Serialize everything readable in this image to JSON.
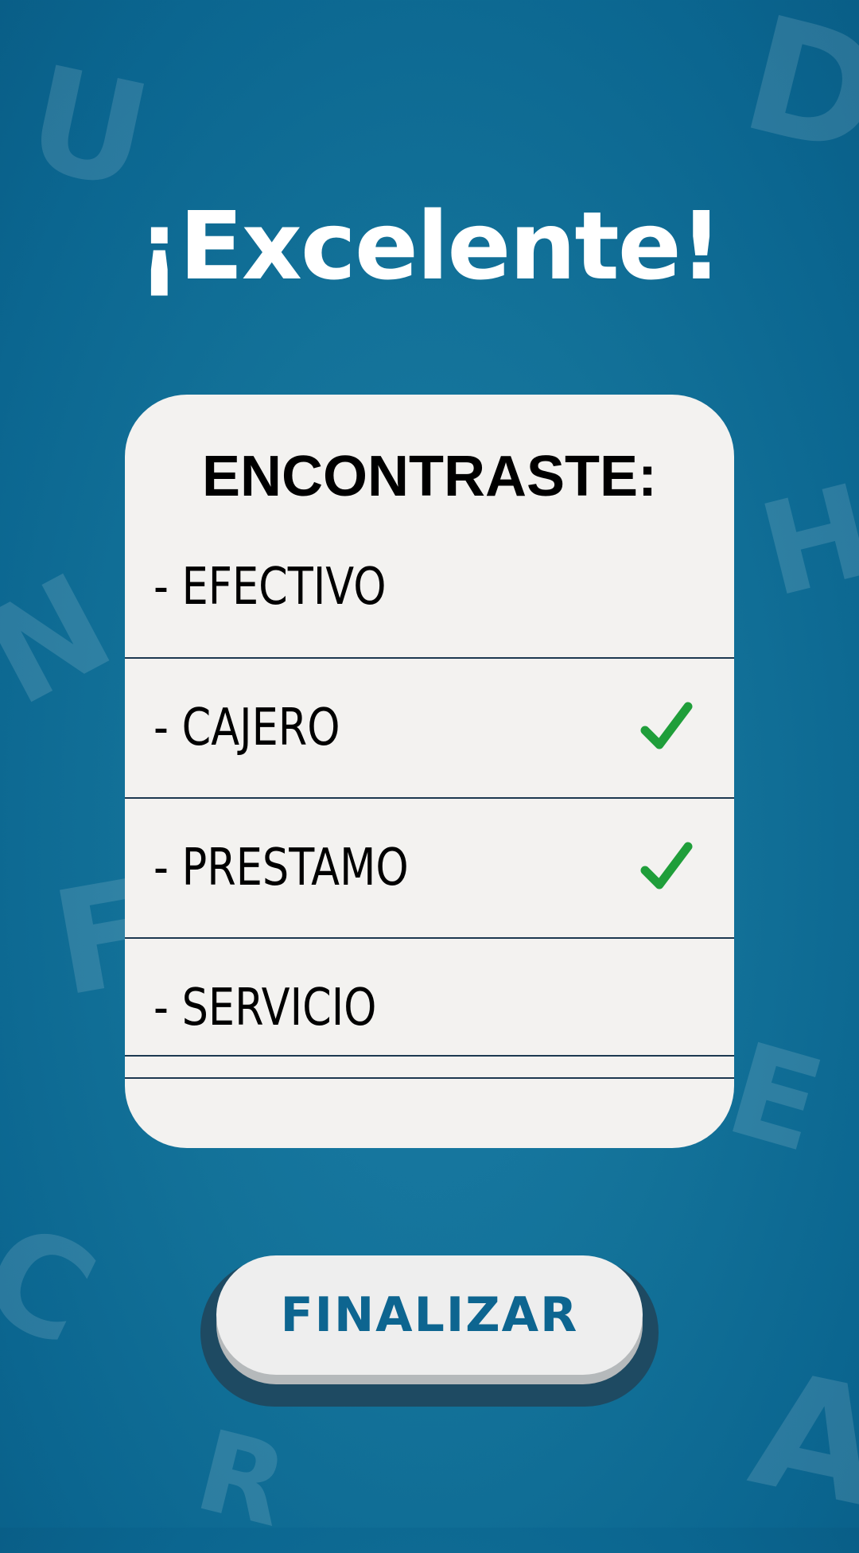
{
  "background_letters": [
    "U",
    "D",
    "H",
    "N",
    "F",
    "E",
    "C",
    "R",
    "A"
  ],
  "title": "¡Excelente!",
  "card": {
    "header": "ENCONTRASTE:",
    "items": [
      {
        "label": "- EFECTIVO",
        "found": false
      },
      {
        "label": "- CAJERO",
        "found": true
      },
      {
        "label": "- PRESTAMO",
        "found": true
      },
      {
        "label": "- SERVICIO",
        "found": false
      }
    ]
  },
  "button": {
    "label": "FINALIZAR"
  },
  "colors": {
    "background": "#137299",
    "card": "#f3f2f0",
    "check": "#1f9e3a",
    "button_text": "#0d6590"
  },
  "icons": {
    "check": "checkmark-icon"
  }
}
